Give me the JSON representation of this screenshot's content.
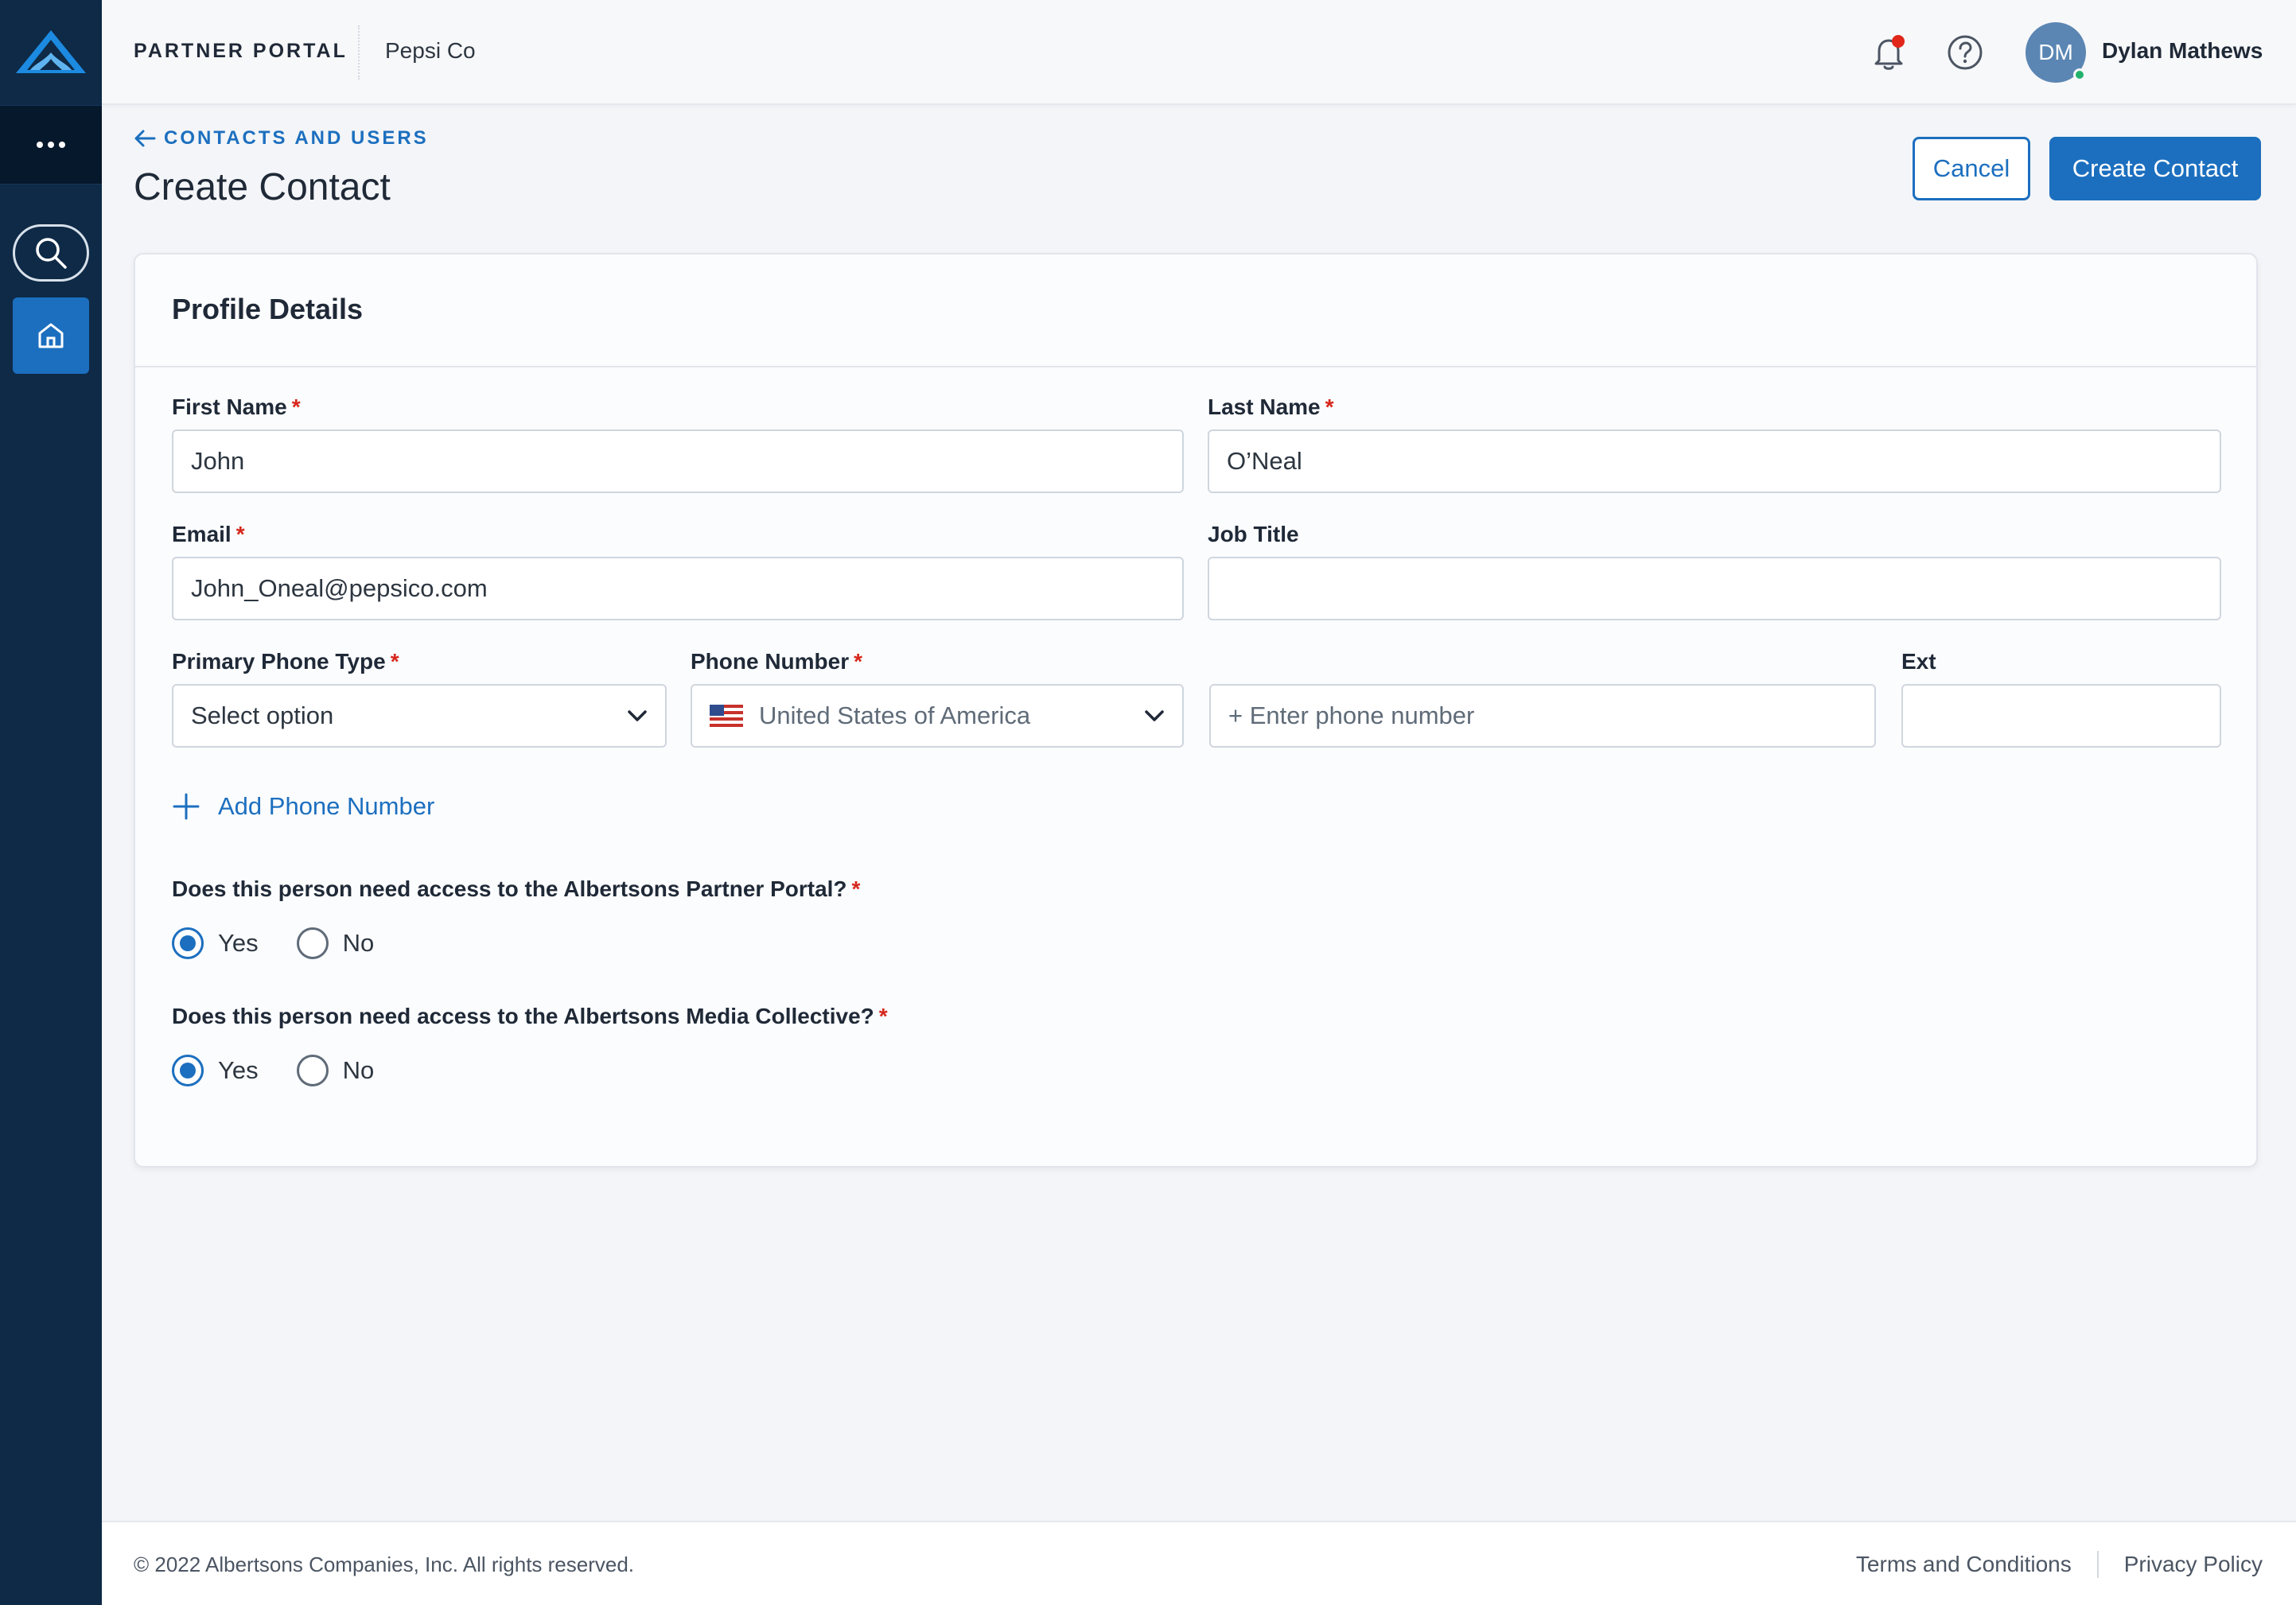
{
  "header": {
    "brand": "PARTNER PORTAL",
    "company": "Pepsi Co",
    "user_initials": "DM",
    "user_name": "Dylan Mathews"
  },
  "nav": {
    "more_icon": "more-dots-icon",
    "search_icon": "search-icon",
    "home_icon": "home-icon"
  },
  "page": {
    "breadcrumb": "CONTACTS AND USERS",
    "title": "Create Contact",
    "cancel_label": "Cancel",
    "create_label": "Create Contact"
  },
  "form": {
    "section_title": "Profile Details",
    "first_name": {
      "label": "First Name",
      "value": "John",
      "required": "*"
    },
    "last_name": {
      "label": "Last Name",
      "value": "O’Neal",
      "required": "*"
    },
    "email": {
      "label": "Email",
      "value": "John_Oneal@pepsico.com",
      "required": "*"
    },
    "job_title": {
      "label": "Job Title",
      "value": ""
    },
    "primary_phone_type": {
      "label": "Primary Phone Type",
      "value": "Select option",
      "required": "*"
    },
    "phone_number": {
      "label": "Phone Number",
      "country": "United States of America",
      "placeholder": "+ Enter phone number",
      "required": "*"
    },
    "ext": {
      "label": "Ext",
      "value": ""
    },
    "add_phone_label": "Add Phone Number",
    "portal_access": {
      "question": "Does this person need access to the Albertsons Partner Portal?",
      "required": "*",
      "options": [
        "Yes",
        "No"
      ],
      "selected": "Yes"
    },
    "media_access": {
      "question": "Does this person need access to the Albertsons Media Collective?",
      "required": "*",
      "options": [
        "Yes",
        "No"
      ],
      "selected": "Yes"
    }
  },
  "footer": {
    "copyright": "© 2022 Albertsons Companies, Inc. All rights reserved.",
    "terms": "Terms and Conditions",
    "privacy": "Privacy Policy"
  },
  "colors": {
    "accent": "#1c6fbf",
    "rail": "#0e2a47",
    "required": "#d6271c",
    "notification": "#e0271a"
  }
}
